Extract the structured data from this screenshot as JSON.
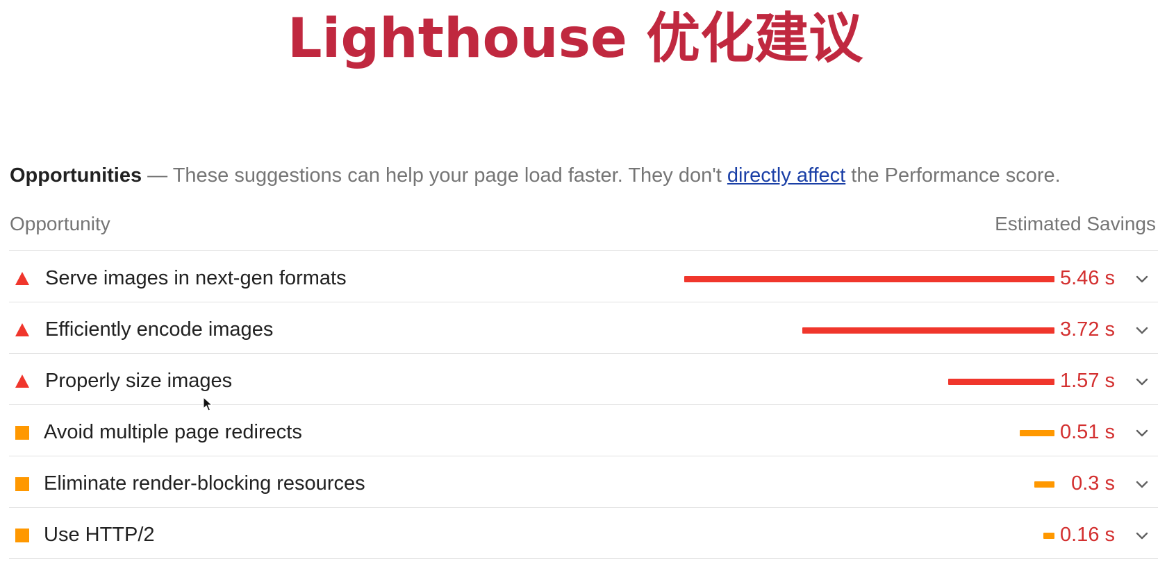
{
  "title": "Lighthouse 优化建议",
  "opportunities": {
    "heading": "Opportunities",
    "dash": " — ",
    "desc_before": "These suggestions can help your page load faster. They don't ",
    "link_text": "directly affect",
    "desc_after": " the Performance score.",
    "col_left": "Opportunity",
    "col_right": "Estimated Savings"
  },
  "colors": {
    "title": "#c0283f",
    "fail": "#f0362c",
    "average": "#ff9800",
    "fail_text": "#d32f2f",
    "average_text": "#d32f2f"
  },
  "items": [
    {
      "label": "Serve images in next-gen formats",
      "value": "5.46 s",
      "savings_s": 5.46,
      "severity": "fail",
      "icon": "warning-triangle-icon"
    },
    {
      "label": "Efficiently encode images",
      "value": "3.72 s",
      "savings_s": 3.72,
      "severity": "fail",
      "icon": "warning-triangle-icon"
    },
    {
      "label": "Properly size images",
      "value": "1.57 s",
      "savings_s": 1.57,
      "severity": "fail",
      "icon": "warning-triangle-icon"
    },
    {
      "label": "Avoid multiple page redirects",
      "value": "0.51 s",
      "savings_s": 0.51,
      "severity": "average",
      "icon": "orange-square-icon"
    },
    {
      "label": "Eliminate render-blocking resources",
      "value": "0.3 s",
      "savings_s": 0.3,
      "severity": "average",
      "icon": "orange-square-icon"
    },
    {
      "label": "Use HTTP/2",
      "value": "0.16 s",
      "savings_s": 0.16,
      "severity": "average",
      "icon": "orange-square-icon"
    }
  ]
}
